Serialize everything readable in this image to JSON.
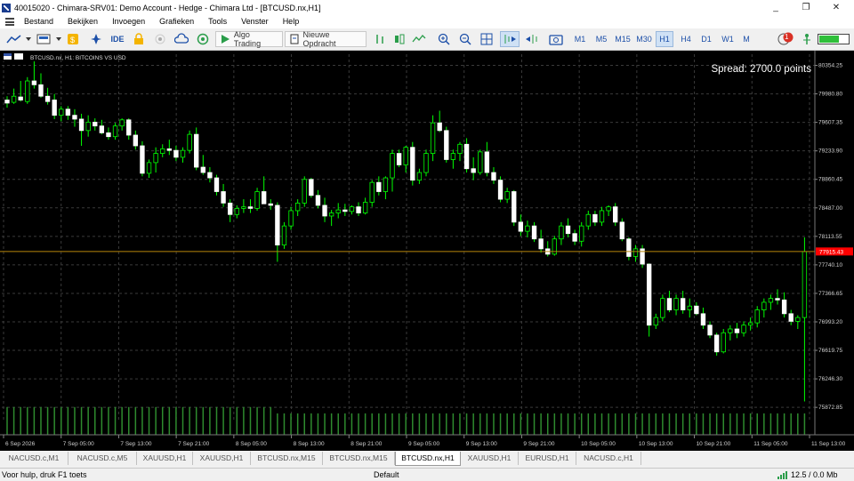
{
  "window": {
    "title": "40015020 - Chimara-SRV01: Demo Account - Hedge - Chimara Ltd - [BTCUSD.nx,H1]",
    "controls": [
      "_",
      "❐",
      "✕"
    ]
  },
  "menu": [
    "Bestand",
    "Bekijken",
    "Invoegen",
    "Grafieken",
    "Tools",
    "Venster",
    "Help"
  ],
  "toolbar": {
    "ide_label": "IDE",
    "algo_trading_label": "Algo Trading",
    "new_order_label": "Nieuwe Opdracht",
    "timeframes": [
      "M1",
      "M5",
      "M15",
      "M30",
      "H1",
      "H4",
      "D1",
      "W1",
      "M"
    ],
    "active_timeframe": "H1",
    "notification_count": "1",
    "signal_strength": 0.7
  },
  "chart": {
    "header": "BTCUSD.nx, H1:  BITCOINS VS USD",
    "spread_text": "Spread: 2700.0 points",
    "current_price_label": "77915.43",
    "current_price": 77915.43,
    "price_axis": [
      "80354.25",
      "79980.80",
      "79607.35",
      "79233.90",
      "78860.45",
      "78487.00",
      "78113.55",
      "77740.10",
      "77366.65",
      "76993.20",
      "76619.75",
      "76246.30",
      "75872.85"
    ],
    "time_axis": [
      "6 Sep 2026",
      "7 Sep 05:00",
      "7 Sep 13:00",
      "7 Sep 21:00",
      "8 Sep 05:00",
      "8 Sep 13:00",
      "8 Sep 21:00",
      "9 Sep 05:00",
      "9 Sep 13:00",
      "9 Sep 21:00",
      "10 Sep 05:00",
      "10 Sep 13:00",
      "10 Sep 21:00",
      "11 Sep 05:00",
      "11 Sep 13:00"
    ],
    "colors": {
      "background": "#000000",
      "grid": "#3a3a3a",
      "bull": "#000000",
      "bull_border": "#00ff00",
      "bear": "#ffffff",
      "price_line": "#b8860b",
      "price_tag": "#ff0000",
      "volume": "#2e8b2e"
    }
  },
  "chart_data": {
    "type": "candlestick",
    "price_range": [
      75700,
      80500
    ],
    "candles": [
      [
        79900,
        79950,
        79800,
        79860
      ],
      [
        79870,
        80050,
        79850,
        79950
      ],
      [
        79940,
        80150,
        79880,
        79900
      ],
      [
        79880,
        80200,
        79850,
        80150
      ],
      [
        80150,
        80430,
        80050,
        80100
      ],
      [
        80100,
        80250,
        79930,
        79950
      ],
      [
        79950,
        80060,
        79840,
        79880
      ],
      [
        79900,
        79980,
        79650,
        79700
      ],
      [
        79700,
        79820,
        79620,
        79780
      ],
      [
        79780,
        79820,
        79640,
        79700
      ],
      [
        79700,
        79780,
        79550,
        79650
      ],
      [
        79650,
        79720,
        79300,
        79500
      ],
      [
        79500,
        79700,
        79420,
        79610
      ],
      [
        79610,
        79660,
        79500,
        79560
      ],
      [
        79560,
        79640,
        79450,
        79470
      ],
      [
        79470,
        79540,
        79380,
        79420
      ],
      [
        79420,
        79600,
        79380,
        79560
      ],
      [
        79560,
        79660,
        79500,
        79640
      ],
      [
        79640,
        79660,
        79380,
        79440
      ],
      [
        79440,
        79500,
        79250,
        79300
      ],
      [
        79300,
        79360,
        78900,
        78940
      ],
      [
        78940,
        79120,
        78880,
        79080
      ],
      [
        79080,
        79280,
        78950,
        79200
      ],
      [
        79200,
        79320,
        79150,
        79260
      ],
      [
        79260,
        79380,
        79180,
        79240
      ],
      [
        79240,
        79300,
        79100,
        79150
      ],
      [
        79150,
        79280,
        79080,
        79240
      ],
      [
        79240,
        79500,
        79200,
        79450
      ],
      [
        79450,
        79540,
        78980,
        79020
      ],
      [
        79020,
        79180,
        78920,
        78950
      ],
      [
        78950,
        79020,
        78820,
        78880
      ],
      [
        78880,
        78920,
        78650,
        78700
      ],
      [
        78700,
        78800,
        78500,
        78550
      ],
      [
        78550,
        78600,
        78300,
        78400
      ],
      [
        78400,
        78520,
        78350,
        78480
      ],
      [
        78480,
        78600,
        78420,
        78500
      ],
      [
        78500,
        78600,
        78420,
        78480
      ],
      [
        78480,
        78750,
        78450,
        78700
      ],
      [
        78700,
        78900,
        78600,
        78540
      ],
      [
        78540,
        78600,
        78460,
        78520
      ],
      [
        78520,
        78560,
        77780,
        78000
      ],
      [
        78000,
        78300,
        77950,
        78250
      ],
      [
        78250,
        78500,
        78200,
        78450
      ],
      [
        78450,
        78600,
        78380,
        78550
      ],
      [
        78550,
        78900,
        78500,
        78860
      ],
      [
        78860,
        78880,
        78620,
        78650
      ],
      [
        78650,
        78720,
        78480,
        78520
      ],
      [
        78520,
        78620,
        78300,
        78380
      ],
      [
        78380,
        78460,
        78250,
        78420
      ],
      [
        78420,
        78550,
        78350,
        78460
      ],
      [
        78460,
        78540,
        78380,
        78440
      ],
      [
        78440,
        78520,
        78400,
        78500
      ],
      [
        78500,
        78560,
        78380,
        78420
      ],
      [
        78420,
        78620,
        78400,
        78560
      ],
      [
        78560,
        78850,
        78500,
        78820
      ],
      [
        78820,
        78900,
        78650,
        78700
      ],
      [
        78700,
        78900,
        78600,
        78880
      ],
      [
        78880,
        79250,
        78700,
        79200
      ],
      [
        79200,
        79250,
        79020,
        79050
      ],
      [
        79050,
        79300,
        78950,
        79280
      ],
      [
        79280,
        79350,
        78780,
        78850
      ],
      [
        78850,
        79000,
        78800,
        78950
      ],
      [
        78950,
        79250,
        78900,
        79200
      ],
      [
        79200,
        79700,
        79100,
        79600
      ],
      [
        79600,
        79760,
        79480,
        79500
      ],
      [
        79500,
        79550,
        79080,
        79120
      ],
      [
        79120,
        79250,
        79000,
        79200
      ],
      [
        79200,
        79350,
        79100,
        79320
      ],
      [
        79320,
        79400,
        78950,
        79000
      ],
      [
        79000,
        79150,
        78850,
        78950
      ],
      [
        78950,
        79250,
        78920,
        79220
      ],
      [
        79220,
        79350,
        78900,
        78950
      ],
      [
        78950,
        79020,
        78800,
        78850
      ],
      [
        78850,
        78900,
        78560,
        78600
      ],
      [
        78600,
        78750,
        78550,
        78700
      ],
      [
        78700,
        78720,
        78250,
        78300
      ],
      [
        78300,
        78400,
        78120,
        78180
      ],
      [
        78180,
        78320,
        78100,
        78250
      ],
      [
        78250,
        78300,
        78040,
        78080
      ],
      [
        78080,
        78200,
        77900,
        77950
      ],
      [
        77950,
        78050,
        77850,
        77880
      ],
      [
        77880,
        78120,
        77860,
        78080
      ],
      [
        78080,
        78300,
        78000,
        78250
      ],
      [
        78250,
        78350,
        78100,
        78150
      ],
      [
        78150,
        78200,
        78000,
        78050
      ],
      [
        78050,
        78300,
        77980,
        78250
      ],
      [
        78250,
        78450,
        78200,
        78400
      ],
      [
        78400,
        78450,
        78250,
        78300
      ],
      [
        78300,
        78500,
        78250,
        78450
      ],
      [
        78450,
        78520,
        78380,
        78500
      ],
      [
        78500,
        78550,
        78250,
        78300
      ],
      [
        78300,
        78350,
        78050,
        78080
      ],
      [
        78080,
        78100,
        77800,
        77850
      ],
      [
        77850,
        78000,
        77780,
        77950
      ],
      [
        77950,
        78000,
        77700,
        77750
      ],
      [
        77750,
        77760,
        76800,
        76950
      ],
      [
        76950,
        77100,
        76900,
        77050
      ],
      [
        77050,
        77350,
        77000,
        77300
      ],
      [
        77300,
        77400,
        77120,
        77150
      ],
      [
        77150,
        77350,
        77080,
        77300
      ],
      [
        77300,
        77400,
        77100,
        77150
      ],
      [
        77150,
        77300,
        77050,
        77200
      ],
      [
        77200,
        77250,
        77080,
        77100
      ],
      [
        77100,
        77180,
        76900,
        76950
      ],
      [
        76950,
        77000,
        76780,
        76820
      ],
      [
        76820,
        76850,
        76550,
        76600
      ],
      [
        76600,
        76900,
        76580,
        76850
      ],
      [
        76850,
        76950,
        76750,
        76900
      ],
      [
        76900,
        76980,
        76780,
        76850
      ],
      [
        76850,
        77000,
        76800,
        76950
      ],
      [
        76950,
        77050,
        76880,
        76980
      ],
      [
        76980,
        77200,
        76920,
        77150
      ],
      [
        77150,
        77300,
        77050,
        77250
      ],
      [
        77250,
        77350,
        77150,
        77300
      ],
      [
        77300,
        77420,
        77220,
        77280
      ],
      [
        77280,
        77380,
        77050,
        77100
      ],
      [
        77100,
        77150,
        76950,
        77000
      ],
      [
        77000,
        77080,
        76900,
        77050
      ],
      [
        77050,
        78100,
        75950,
        77915
      ]
    ],
    "volumes": [
      0.52,
      0.52,
      0.52,
      0.52,
      0.52,
      0.52,
      0.52,
      0.52,
      0.52,
      0.52,
      0.52,
      0.52,
      0.52,
      0.52,
      0.52,
      0.52,
      0.52,
      0.52,
      0.52,
      0.52,
      0.52,
      0.52,
      0.52,
      0.52,
      0.52,
      0.52,
      0.52,
      0.52,
      0.52,
      0.52,
      0.52,
      0.52,
      0.52,
      0.52,
      0.52,
      0.52,
      0.52,
      0.52,
      0.52,
      0.52,
      0.4,
      0.4,
      0.4,
      0.4,
      0.4,
      0.4,
      0.4,
      0.4,
      0.4,
      0.4,
      0.4,
      0.4,
      0.4,
      0.4,
      0.4,
      0.4,
      0.4,
      0.4,
      0.4,
      0.4,
      0.4,
      0.4,
      0.4,
      0.4,
      0.4,
      0.4,
      0.4,
      0.4,
      0.4,
      0.4,
      0.4,
      0.4,
      0.4,
      0.4,
      0.4,
      0.4,
      0.4,
      0.4,
      0.4,
      0.4,
      0.4,
      0.4,
      0.4,
      0.4,
      0.4,
      0.4,
      0.4,
      0.4,
      0.4,
      0.4,
      0.4,
      0.4,
      0.4,
      0.4,
      0.4,
      0.4,
      0.4,
      0.4,
      0.4,
      0.4,
      0.4,
      0.4,
      0.4,
      0.4,
      0.4,
      0.4,
      0.4,
      0.4,
      0.4,
      0.4,
      0.4,
      0.4,
      0.4,
      0.4,
      0.4,
      0.4,
      0.4,
      0.4,
      0.4,
      0.4,
      0.4,
      0.4,
      0.4,
      0.4,
      0.4,
      0.4,
      0.4,
      0.4,
      0.4,
      0.4,
      0.4,
      0.4,
      0.4,
      0.4,
      0.4,
      0.4,
      0.4,
      0.4,
      0.4
    ]
  },
  "tabs": [
    "NACUSD.c,M1",
    "NACUSD.c,M5",
    "XAUUSD,H1",
    "XAUUSD,H1",
    "BTCUSD.nx,M15",
    "BTCUSD.nx,M15",
    "BTCUSD.nx,H1",
    "XAUUSD,H1",
    "EURUSD,H1",
    "NACUSD.c,H1"
  ],
  "active_tab": "BTCUSD.nx,H1",
  "status": {
    "help": "Voor hulp, druk F1 toets",
    "profile": "Default",
    "traffic": "12.5 / 0.0 Mb"
  }
}
